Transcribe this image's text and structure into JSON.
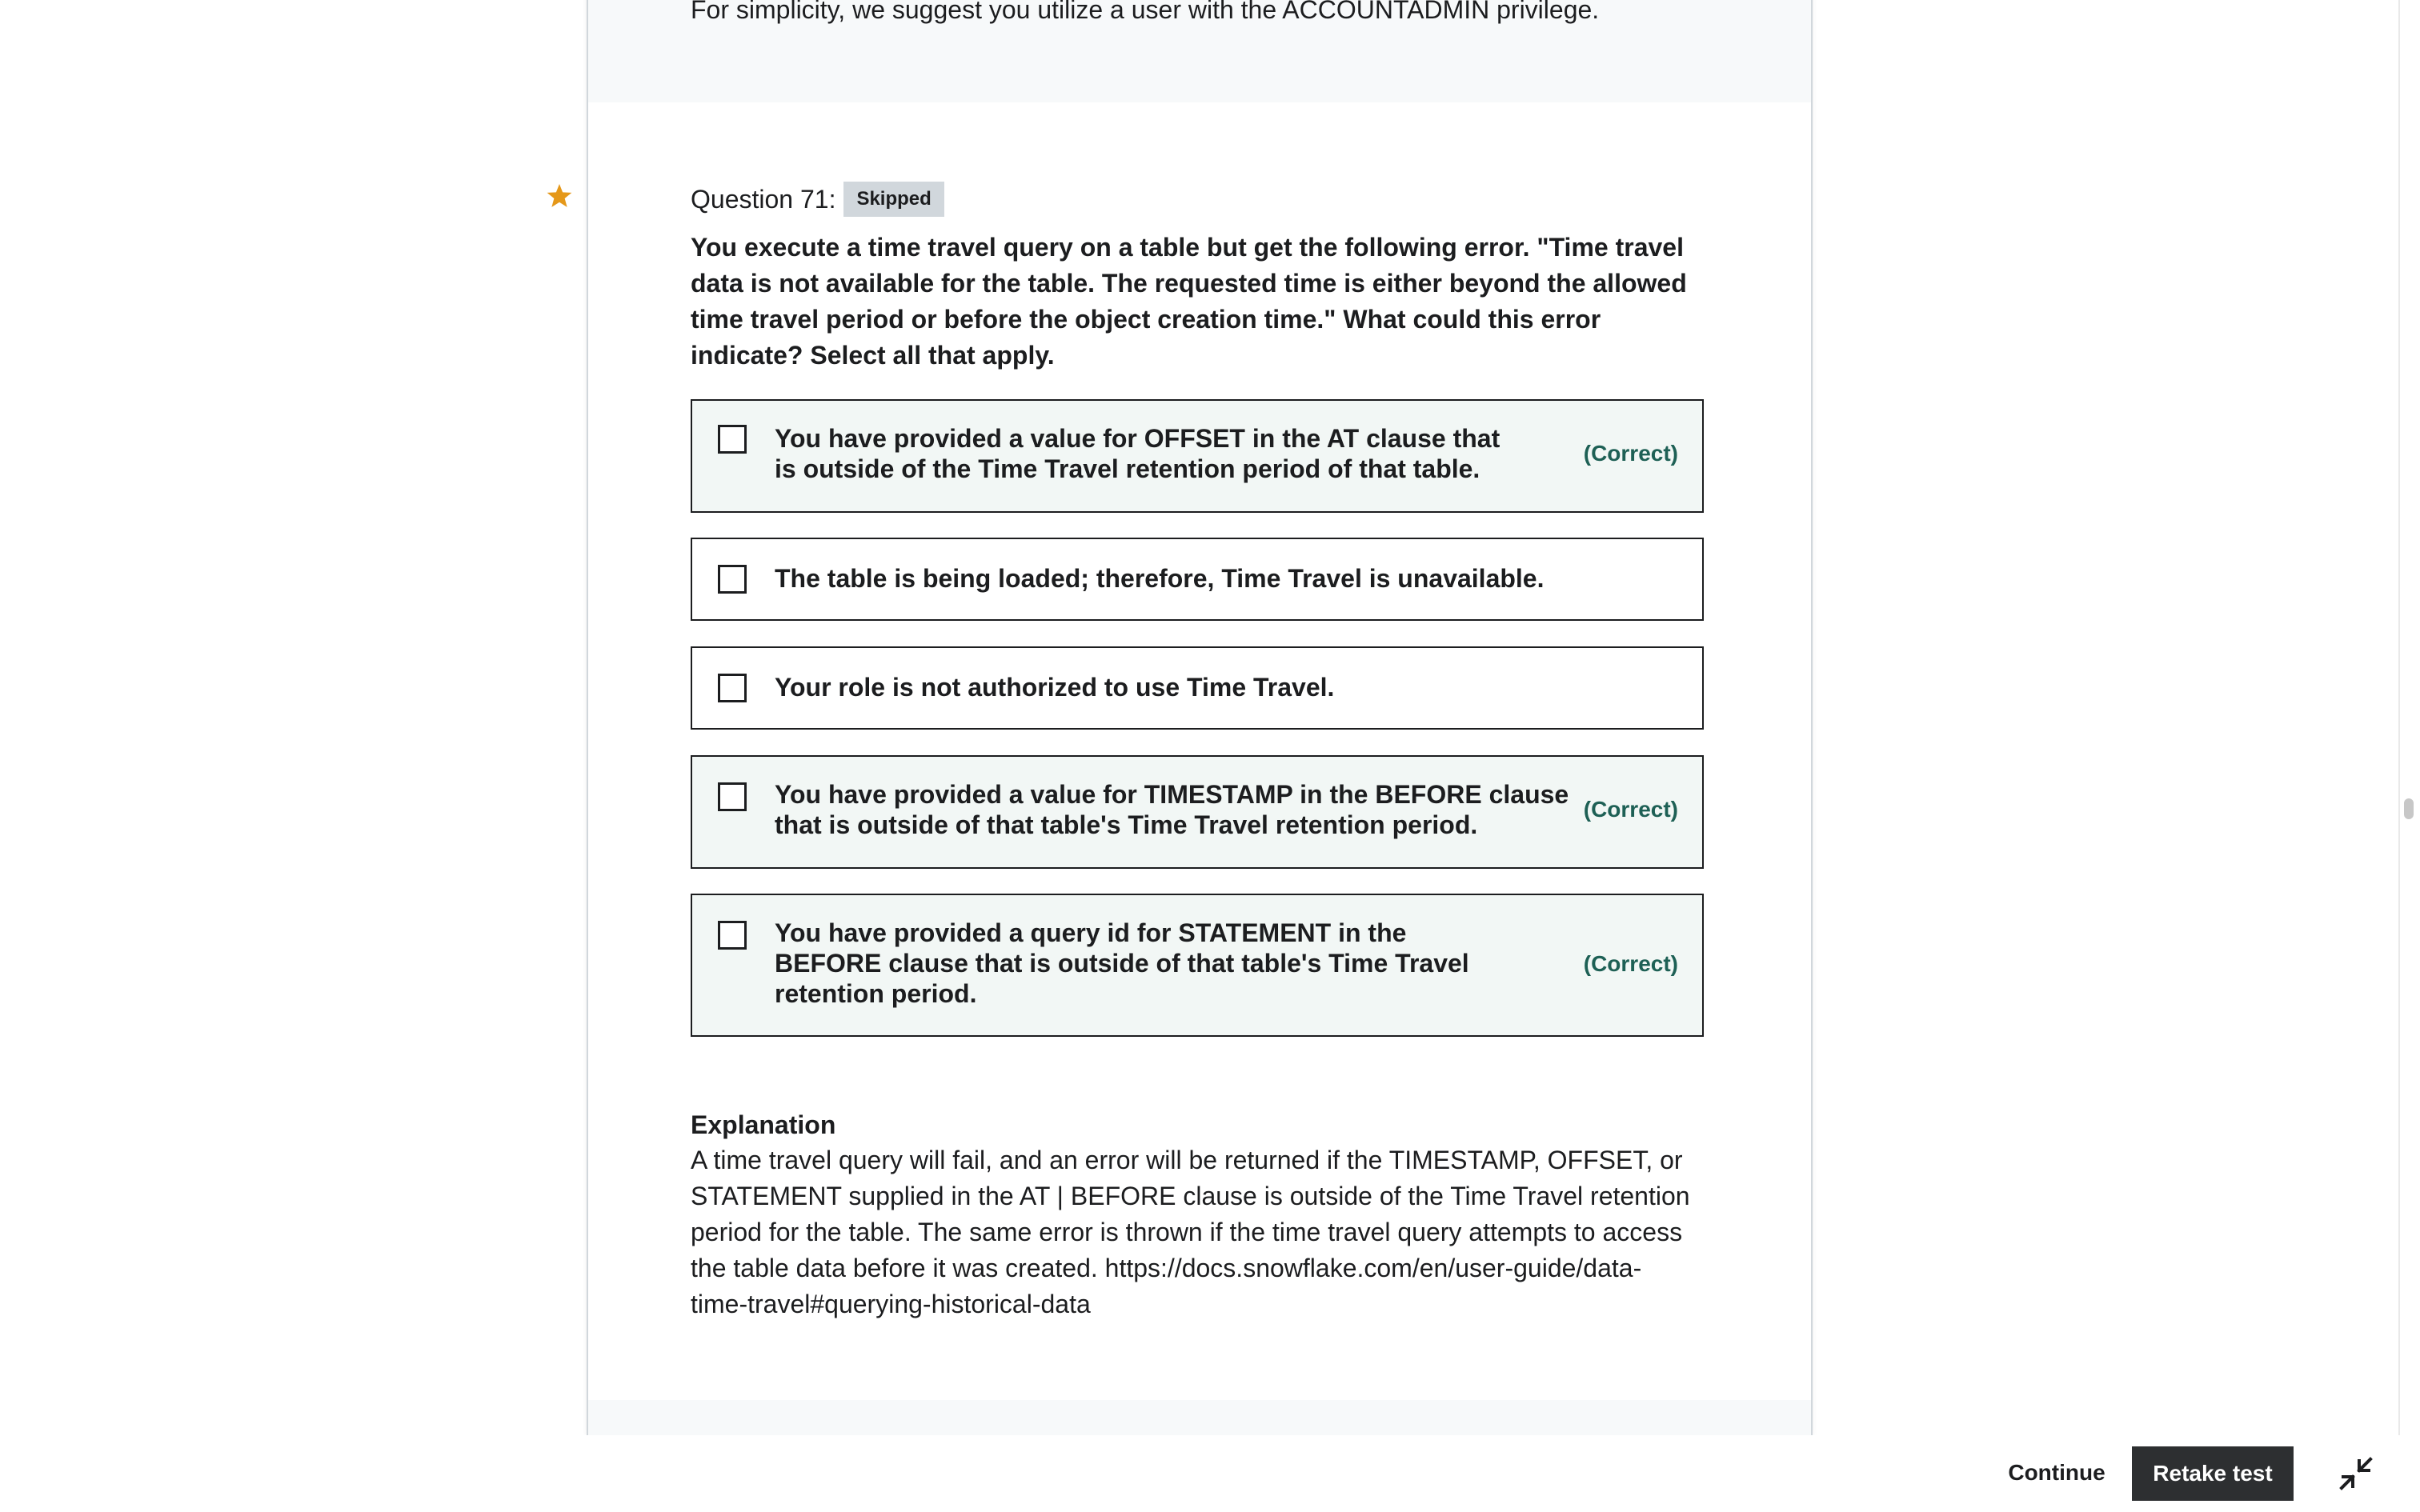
{
  "previous_section": {
    "text": "For simplicity, we suggest you utilize a user with the ACCOUNTADMIN privilege."
  },
  "question": {
    "label": "Question 71:",
    "status_badge": "Skipped",
    "text": "You execute a time travel query on a table but get the following error. \"Time travel data is not available for the table. The requested time is either beyond the allowed time travel period or before the object creation time.\" What could this error indicate? Select all that apply.",
    "bookmark_icon": "star-icon",
    "bookmark_color": "#e59819"
  },
  "options": [
    {
      "text": "You have provided a value for OFFSET in the AT clause that is outside of the Time Travel retention period of that table.",
      "tag": "(Correct)",
      "checked": false
    },
    {
      "text": "The table is being loaded; therefore, Time Travel is unavailable.",
      "tag": "",
      "checked": false
    },
    {
      "text": "Your role is not authorized to use Time Travel.",
      "tag": "",
      "checked": false
    },
    {
      "text": "You have provided a value for TIMESTAMP in the BEFORE clause that is outside of that table's Time Travel retention period.",
      "tag": "(Correct)",
      "checked": false
    },
    {
      "text": "You have provided a query id for STATEMENT in the BEFORE clause that is outside of that table's Time Travel retention period.",
      "tag": "(Correct)",
      "checked": false
    }
  ],
  "explanation": {
    "title": "Explanation",
    "body": "A time travel query will fail, and an error will be returned if the TIMESTAMP, OFFSET, or STATEMENT supplied in the AT | BEFORE clause is outside of the Time Travel retention period for the table. The same error is thrown if the time travel query attempts to access the table data before it was created. https://docs.snowflake.com/en/user-guide/data-time-travel#querying-historical-data"
  },
  "footer": {
    "continue_label": "Continue",
    "retake_label": "Retake test",
    "exit_fullscreen_icon": "exit-fullscreen-icon"
  },
  "colors": {
    "correct_text": "#1e6055",
    "correct_bg": "#f2f7f5",
    "badge_bg": "#d1d7dc",
    "primary_button_bg": "#2d2f31"
  }
}
